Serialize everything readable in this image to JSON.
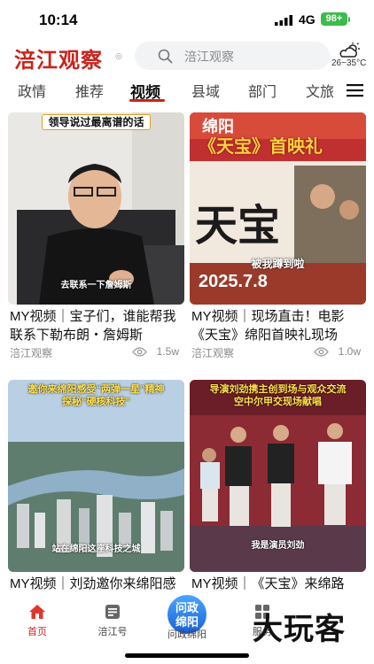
{
  "status_bar": {
    "time": "10:14",
    "network": "4G",
    "battery": "98+"
  },
  "header": {
    "logo": "涪江观察",
    "search_placeholder": "涪江观察",
    "temperature": "26~35°C",
    "icons": {
      "search": "search-icon",
      "weather": "cloud-sun-icon",
      "menu": "menu-icon"
    }
  },
  "tabs": [
    "政情",
    "推荐",
    "视频",
    "县域",
    "部门",
    "文旅"
  ],
  "active_tab": "视频",
  "videos": [
    {
      "title": "MY视频｜宝子们，谁能帮我联系下勒布朗・詹姆斯",
      "source": "涪江观察",
      "views": "1.5w",
      "caption_top": "领导说过最离谱的话",
      "subtitle": "去联系一下詹姆斯"
    },
    {
      "title": "MY视频｜现场直击！电影《天宝》绵阳首映礼现场",
      "source": "涪江观察",
      "views": "1.0w",
      "caption_top": "绵阳",
      "poster_title": "《天宝》首映礼",
      "poster_big": "天宝",
      "date": "2025.7.8",
      "subtitle": "被我蹲到啦"
    },
    {
      "title": "MY视频｜刘劲邀你来绵阳感受“两弹一星”精神",
      "caption_top": "邀你来绵阳感受“两弹一星”精神",
      "caption_top2": "探秘“硬核科技”",
      "subtitle": "站在绵阳这座科技之城"
    },
    {
      "title": "MY视频｜《天宝》来绵路演，刘劲、贾冰…",
      "caption_top": "导演刘劲携主创到场与观众交流",
      "caption_top2": "空中尔甲交现场献唱",
      "subtitle": "我是演员刘劲"
    }
  ],
  "bottom_nav": [
    {
      "label": "首页",
      "icon": "home-icon"
    },
    {
      "label": "涪江号",
      "icon": "newspaper-icon"
    },
    {
      "label": "问政绵阳",
      "icon": "question-bubble-icon"
    },
    {
      "label": "服务",
      "icon": "grid-icon"
    }
  ],
  "center_button": "问政\n绵阳",
  "watermark": "大玩客",
  "colors": {
    "brand_red": "#c8241c",
    "tab_active": "#111111",
    "battery_green": "#3dbb4a"
  }
}
